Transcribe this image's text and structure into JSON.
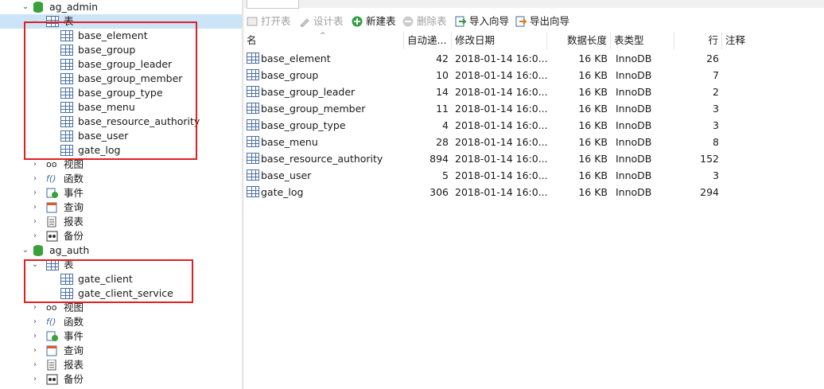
{
  "tree": {
    "db1": {
      "name": "ag_admin",
      "tables_label": "表",
      "tables": [
        "base_element",
        "base_group",
        "base_group_leader",
        "base_group_member",
        "base_group_type",
        "base_menu",
        "base_resource_authority",
        "base_user",
        "gate_log"
      ],
      "views_label": "视图",
      "functions_label": "函数",
      "events_label": "事件",
      "queries_label": "查询",
      "reports_label": "报表",
      "backups_label": "备份"
    },
    "db2": {
      "name": "ag_auth",
      "tables_label": "表",
      "tables": [
        "gate_client",
        "gate_client_service"
      ],
      "views_label": "视图",
      "functions_label": "函数",
      "events_label": "事件",
      "queries_label": "查询",
      "reports_label": "报表",
      "backups_label": "备份"
    }
  },
  "toolbar": {
    "open_table": "打开表",
    "design_table": "设计表",
    "new_table": "新建表",
    "delete_table": "删除表",
    "import_wizard": "导入向导",
    "export_wizard": "导出向导"
  },
  "table_list": {
    "columns": [
      "名",
      "自动递...",
      "修改日期",
      "数据长度",
      "表类型",
      "行",
      "注释"
    ],
    "rows": [
      {
        "name": "base_element",
        "auto": "42",
        "modified": "2018-01-14 16:0...",
        "size": "16 KB",
        "engine": "InnoDB",
        "rows": "26"
      },
      {
        "name": "base_group",
        "auto": "10",
        "modified": "2018-01-14 16:0...",
        "size": "16 KB",
        "engine": "InnoDB",
        "rows": "7"
      },
      {
        "name": "base_group_leader",
        "auto": "14",
        "modified": "2018-01-14 16:0...",
        "size": "16 KB",
        "engine": "InnoDB",
        "rows": "2"
      },
      {
        "name": "base_group_member",
        "auto": "11",
        "modified": "2018-01-14 16:0...",
        "size": "16 KB",
        "engine": "InnoDB",
        "rows": "3"
      },
      {
        "name": "base_group_type",
        "auto": "4",
        "modified": "2018-01-14 16:0...",
        "size": "16 KB",
        "engine": "InnoDB",
        "rows": "3"
      },
      {
        "name": "base_menu",
        "auto": "28",
        "modified": "2018-01-14 16:0...",
        "size": "16 KB",
        "engine": "InnoDB",
        "rows": "8"
      },
      {
        "name": "base_resource_authority",
        "auto": "894",
        "modified": "2018-01-14 16:0...",
        "size": "16 KB",
        "engine": "InnoDB",
        "rows": "152"
      },
      {
        "name": "base_user",
        "auto": "5",
        "modified": "2018-01-14 16:0...",
        "size": "16 KB",
        "engine": "InnoDB",
        "rows": "3"
      },
      {
        "name": "gate_log",
        "auto": "306",
        "modified": "2018-01-14 16:0...",
        "size": "16 KB",
        "engine": "InnoDB",
        "rows": "294"
      }
    ]
  },
  "colors": {
    "selection": "#cce4f7",
    "highlight_box": "#e02020",
    "db_icon": "#3aa03a"
  }
}
